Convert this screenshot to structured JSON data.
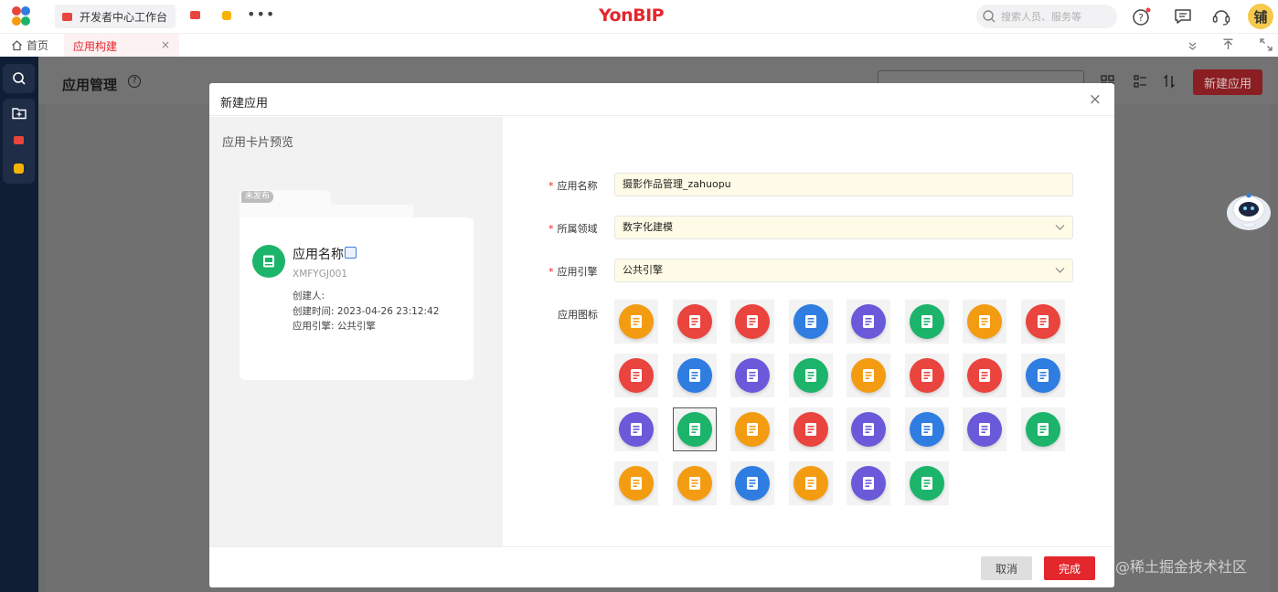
{
  "topbar": {
    "tab_label": "开发者中心工作台",
    "more": "•••",
    "brand": "YonBIP",
    "search_placeholder": "搜索人员、服务等",
    "avatar_text": "铺"
  },
  "tabbar": {
    "home_label": "首页",
    "active_tab_label": "应用构建",
    "close_symbol": "×"
  },
  "page": {
    "title": "应用管理",
    "help_symbol": "?",
    "new_app_label": "新建应用"
  },
  "modal": {
    "title": "新建应用",
    "close_symbol": "×",
    "preview_title": "应用卡片预览",
    "card": {
      "status": "未发布",
      "name": "应用名称",
      "code": "XMFYGJ001",
      "creator": "创建人:",
      "created_time": "创建时间: 2023-04-26 23:12:42",
      "engine": "应用引擎: 公共引擎"
    },
    "form": {
      "required_mark": "*",
      "name_label": "应用名称",
      "name_value": "摄影作品管理_zahuopu",
      "domain_label": "所属领域",
      "domain_value": "数字化建模",
      "engine_label": "应用引擎",
      "engine_value": "公共引擎",
      "icon_label": "应用图标"
    },
    "icons": [
      [
        "#f39c12",
        "#e9443e",
        "#e9443e",
        "#2f7de1",
        "#6a5ad9",
        "#1cb46a",
        "#f39c12",
        "#e9443e"
      ],
      [
        "#e9443e",
        "#2f7de1",
        "#6a5ad9",
        "#1cb46a",
        "#f39c12",
        "#e9443e",
        "#e9443e",
        "#2f7de1"
      ],
      [
        "#6a5ad9",
        "#1cb46a",
        "#f39c12",
        "#e9443e",
        "#6a5ad9",
        "#2f7de1",
        "#6a5ad9",
        "#1cb46a"
      ],
      [
        "#f39c12",
        "#f39c12",
        "#2f7de1",
        "#f39c12",
        "#6a5ad9",
        "#1cb46a"
      ]
    ],
    "selected_icon": [
      2,
      1
    ],
    "cancel_label": "取消",
    "ok_label": "完成"
  },
  "watermark": "@稀土掘金技术社区"
}
